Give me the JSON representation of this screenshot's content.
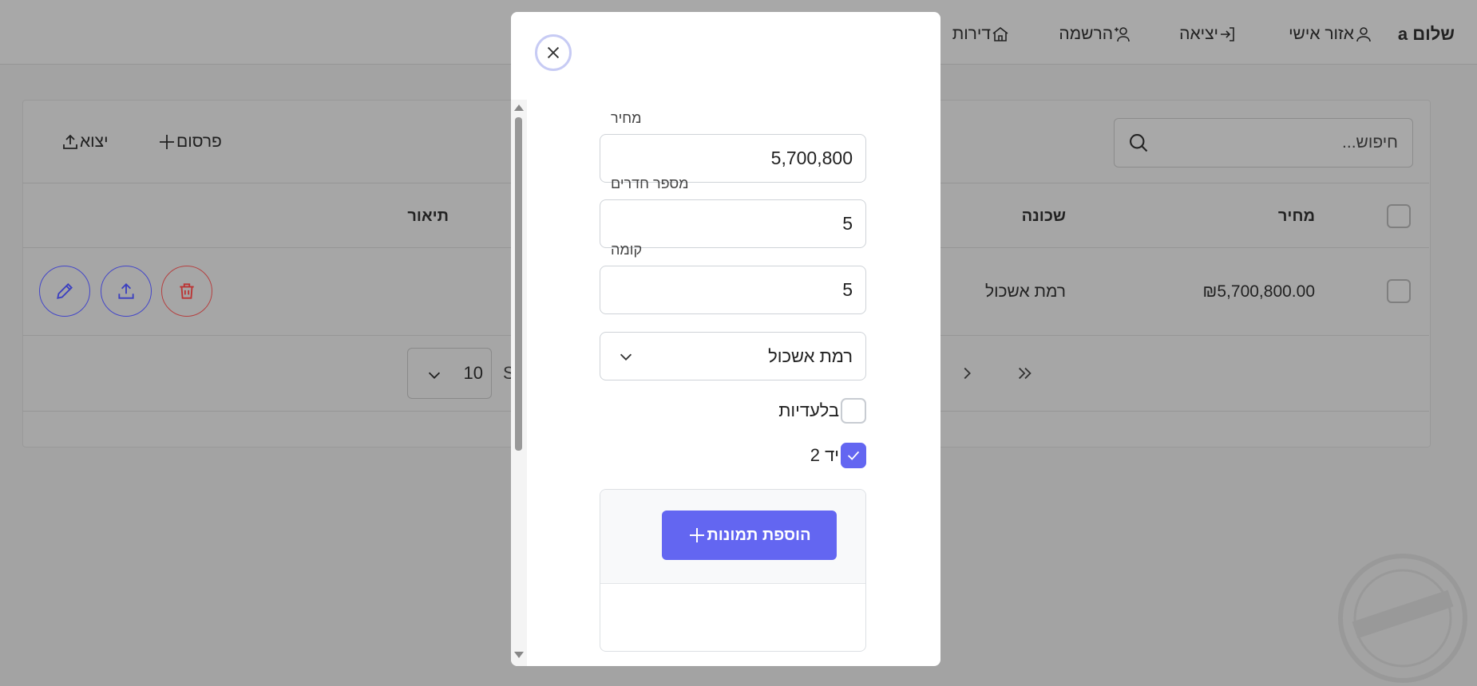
{
  "nav": {
    "greeting": "שלום a",
    "personal": "אזור אישי",
    "logout": "יציאה",
    "register": "הרשמה",
    "apartments": "דירות"
  },
  "toolbar": {
    "search_placeholder": "חיפוש...",
    "publish": "פרסום",
    "export": "יצוא"
  },
  "table": {
    "headers": {
      "price": "מחיר",
      "neighborhood": "שכונה",
      "description": "תיאור"
    },
    "rows": [
      {
        "price": "₪5,700,800.00",
        "neighborhood": "רמת אשכול"
      }
    ]
  },
  "pager": {
    "rows_per_page": "10",
    "partial_label": "S"
  },
  "modal": {
    "price_label": "מחיר",
    "price_value": "5,700,800",
    "rooms_label": "מספר חדרים",
    "rooms_value": "5",
    "floor_label": "קומה",
    "floor_value": "5",
    "neighborhood_value": "רמת אשכול",
    "exclusive_label": "בלעדיות",
    "exclusive_checked": false,
    "second_hand_label": "יד 2",
    "second_hand_checked": true,
    "add_images": "הוספת תמונות"
  },
  "colors": {
    "accent": "#6366f1",
    "danger": "#dc2626",
    "overlay": "#a3a3a3"
  }
}
